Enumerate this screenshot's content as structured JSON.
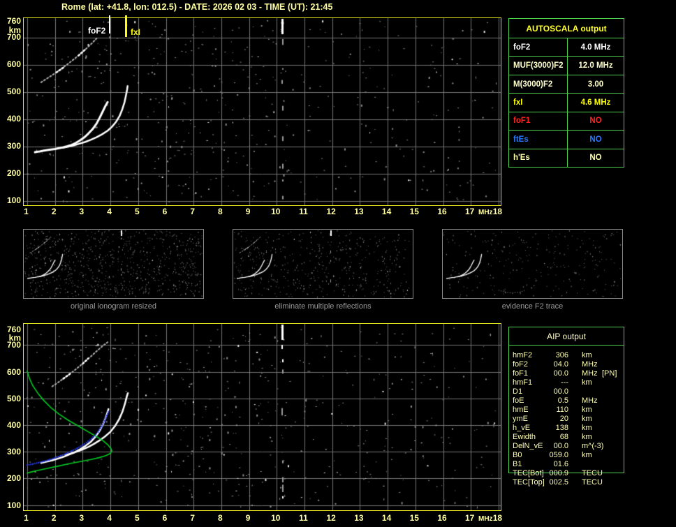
{
  "title": "Rome (lat: +41.8, lon: 012.5) - DATE: 2026 02 03 - TIME (UT): 21:45",
  "colors": {
    "pale_yellow": "#ffffa2",
    "bright_yellow": "#ffff00",
    "plot_border_yellow": "#e8e81e",
    "table_green": "#4cd24c",
    "profile_green": "#00cc22",
    "restored_trace_blue": "#2236e8",
    "alert_red": "#ff2222",
    "es_blue": "#2979ff",
    "grid_gray": "#767676"
  },
  "autoscala_table": {
    "header": "AUTOSCALA output",
    "rows": [
      {
        "label": "foF2",
        "value": "4.0 MHz",
        "color": "#ffffff"
      },
      {
        "label": "MUF(3000)F2",
        "value": "12.0 MHz",
        "color": "#ffffcc"
      },
      {
        "label": "M(3000)F2",
        "value": "3.00",
        "color": "#ffffcc"
      },
      {
        "label": "fxI",
        "value": "4.6 MHz",
        "color": "#ffff00"
      },
      {
        "label": "foF1",
        "value": "NO",
        "color": "#ff2222"
      },
      {
        "label": "ftEs",
        "value": "NO",
        "color": "#2979ff"
      },
      {
        "label": "h'Es",
        "value": "NO",
        "color": "#ffffaa"
      }
    ]
  },
  "aip_table": {
    "header": "AIP output",
    "rows": [
      {
        "label": "hmF2",
        "value": "306",
        "unit": "km",
        "extra": ""
      },
      {
        "label": "foF2",
        "value": "04.0",
        "unit": "MHz",
        "extra": ""
      },
      {
        "label": "foF1",
        "value": "00.0",
        "unit": "MHz",
        "extra": "[PN]"
      },
      {
        "label": "hmF1",
        "value": "---",
        "unit": "km",
        "extra": ""
      },
      {
        "label": "D1",
        "value": "00.0",
        "unit": "",
        "extra": ""
      },
      {
        "label": "foE",
        "value": "0.5",
        "unit": "MHz",
        "extra": ""
      },
      {
        "label": "hmE",
        "value": "110",
        "unit": "km",
        "extra": ""
      },
      {
        "label": "ymE",
        "value": "20",
        "unit": "km",
        "extra": ""
      },
      {
        "label": "h_vE",
        "value": "138",
        "unit": "km",
        "extra": ""
      },
      {
        "label": "Ewidth",
        "value": "68",
        "unit": "km",
        "extra": ""
      },
      {
        "label": "DelN_vE",
        "value": "00.0",
        "unit": "m^(-3)",
        "extra": ""
      },
      {
        "label": "B0",
        "value": "059.0",
        "unit": "km",
        "extra": ""
      },
      {
        "label": "B1",
        "value": "01.6",
        "unit": "",
        "extra": ""
      },
      {
        "label": "TEC[Bot]",
        "value": "000.9",
        "unit": "TECU",
        "extra": ""
      },
      {
        "label": "TEC[Top]",
        "value": "002.5",
        "unit": "TECU",
        "extra": ""
      }
    ]
  },
  "thumbnails": [
    {
      "caption": "original ionogram resized",
      "noise_dots": 780,
      "show_second_order": true,
      "show_interference": true
    },
    {
      "caption": "eliminate multiple reflections",
      "noise_dots": 470,
      "show_second_order": true,
      "show_interference": true
    },
    {
      "caption": "evidence F2 trace",
      "noise_dots": 250,
      "show_second_order": false,
      "show_interference": false,
      "extra_arc": [
        [
          6.3,
          160
        ],
        [
          6.9,
          140
        ],
        [
          7.6,
          132
        ],
        [
          8.3,
          142
        ],
        [
          8.7,
          158
        ]
      ]
    }
  ],
  "chart_data": [
    {
      "id": "main-ionogram",
      "type": "scatter",
      "xlabel": "MHz",
      "ylabel": "km",
      "xlim": [
        1,
        18
      ],
      "ylim": [
        100,
        760
      ],
      "xticks": [
        1,
        2,
        3,
        4,
        5,
        6,
        7,
        8,
        9,
        10,
        11,
        12,
        13,
        14,
        15,
        16,
        17,
        18
      ],
      "yticks": [
        760,
        700,
        600,
        500,
        400,
        300,
        200,
        100
      ],
      "grid": true,
      "markers": [
        {
          "name": "foF2",
          "x": 4.0,
          "color": "#ffffff"
        },
        {
          "name": "fxI",
          "x": 4.6,
          "color": "#ffff00"
        }
      ],
      "noise_dots": 520,
      "seed": 11,
      "series": [
        {
          "name": "F2-trace-ordinary",
          "style": "trace",
          "color": "#ffffff",
          "width": 3,
          "points": [
            [
              1.28,
              279
            ],
            [
              1.38,
              281
            ],
            [
              1.45,
              282
            ],
            [
              1.6,
              285
            ],
            [
              1.8,
              288
            ],
            [
              2.0,
              291
            ],
            [
              2.15,
              294
            ],
            [
              2.3,
              297
            ],
            [
              2.45,
              301
            ],
            [
              2.6,
              306
            ],
            [
              2.75,
              313
            ],
            [
              2.9,
              322
            ],
            [
              3.05,
              333
            ],
            [
              3.2,
              347
            ],
            [
              3.35,
              363
            ],
            [
              3.5,
              384
            ],
            [
              3.62,
              407
            ],
            [
              3.72,
              428
            ],
            [
              3.8,
              445
            ],
            [
              3.86,
              456
            ],
            [
              3.9,
              463
            ]
          ]
        },
        {
          "name": "F2-trace-extraordinary",
          "style": "trace",
          "color": "#ffffff",
          "width": 2.5,
          "points": [
            [
              2.3,
              296
            ],
            [
              2.5,
              300
            ],
            [
              2.7,
              305
            ],
            [
              2.9,
              311
            ],
            [
              3.1,
              317
            ],
            [
              3.3,
              325
            ],
            [
              3.5,
              334
            ],
            [
              3.7,
              345
            ],
            [
              3.9,
              358
            ],
            [
              4.05,
              372
            ],
            [
              4.2,
              390
            ],
            [
              4.33,
              412
            ],
            [
              4.43,
              437
            ],
            [
              4.51,
              463
            ],
            [
              4.56,
              487
            ],
            [
              4.6,
              508
            ],
            [
              4.62,
              522
            ]
          ]
        },
        {
          "name": "second-order-reflection",
          "style": "dashtrace",
          "color": "#b0b0b0",
          "width": 2,
          "points": [
            [
              1.5,
              536
            ],
            [
              1.7,
              549
            ],
            [
              1.9,
              562
            ],
            [
              2.1,
              576
            ],
            [
              2.3,
              591
            ],
            [
              2.5,
              606
            ],
            [
              2.7,
              622
            ],
            [
              2.9,
              639
            ],
            [
              3.1,
              657
            ],
            [
              3.3,
              676
            ],
            [
              3.5,
              697
            ]
          ]
        },
        {
          "name": "second-order-bright-1",
          "style": "dashtrace",
          "color": "#ffffff",
          "width": 2.5,
          "points": [
            [
              2.05,
              572
            ],
            [
              2.35,
              593
            ]
          ]
        },
        {
          "name": "second-order-bright-2",
          "style": "dashtrace",
          "color": "#ffffff",
          "width": 2.5,
          "points": [
            [
              2.85,
              634
            ],
            [
              3.12,
              659
            ]
          ]
        },
        {
          "name": "interference-line",
          "style": "vnoise",
          "x": 10.2
        }
      ]
    },
    {
      "id": "profile-ionogram",
      "type": "scatter",
      "xlabel": "MHz",
      "ylabel": "km",
      "xlim": [
        1,
        18
      ],
      "ylim": [
        100,
        760
      ],
      "xticks": [
        1,
        2,
        3,
        4,
        5,
        6,
        7,
        8,
        9,
        10,
        11,
        12,
        13,
        14,
        15,
        16,
        17,
        18
      ],
      "yticks": [
        760,
        700,
        600,
        500,
        400,
        300,
        200,
        100
      ],
      "grid": true,
      "markers": [],
      "noise_dots": 560,
      "seed": 22,
      "series": [
        {
          "name": "F2-trace-ordinary",
          "style": "trace",
          "color": "#ffffff",
          "width": 2.5,
          "points": [
            [
              1.5,
              258
            ],
            [
              1.7,
              263
            ],
            [
              1.9,
              268
            ],
            [
              2.1,
              274
            ],
            [
              2.3,
              281
            ],
            [
              2.5,
              289
            ],
            [
              2.7,
              298
            ],
            [
              2.9,
              309
            ],
            [
              3.1,
              322
            ],
            [
              3.3,
              338
            ],
            [
              3.45,
              355
            ],
            [
              3.6,
              377
            ],
            [
              3.72,
              400
            ],
            [
              3.82,
              425
            ],
            [
              3.89,
              447
            ],
            [
              3.93,
              460
            ]
          ]
        },
        {
          "name": "F2-trace-extraordinary",
          "style": "trace",
          "color": "#ffffff",
          "width": 2.5,
          "points": [
            [
              2.4,
              288
            ],
            [
              2.6,
              294
            ],
            [
              2.8,
              301
            ],
            [
              3.0,
              309
            ],
            [
              3.2,
              318
            ],
            [
              3.4,
              329
            ],
            [
              3.6,
              342
            ],
            [
              3.8,
              357
            ],
            [
              4.0,
              375
            ],
            [
              4.17,
              397
            ],
            [
              4.32,
              423
            ],
            [
              4.44,
              452
            ],
            [
              4.53,
              482
            ],
            [
              4.59,
              507
            ],
            [
              4.63,
              520
            ]
          ]
        },
        {
          "name": "second-order-reflection",
          "style": "dashtrace",
          "color": "#b0b0b0",
          "width": 2,
          "points": [
            [
              1.9,
              545
            ],
            [
              2.1,
              559
            ],
            [
              2.3,
              574
            ],
            [
              2.5,
              589
            ],
            [
              2.7,
              605
            ],
            [
              2.9,
              622
            ],
            [
              3.1,
              640
            ],
            [
              3.3,
              658
            ],
            [
              3.5,
              677
            ],
            [
              3.7,
              695
            ],
            [
              3.9,
              711
            ]
          ]
        },
        {
          "name": "second-order-bright-1",
          "style": "dashtrace",
          "color": "#ffffff",
          "width": 2.5,
          "points": [
            [
              2.3,
              574
            ],
            [
              2.55,
              593
            ]
          ]
        },
        {
          "name": "second-order-bright-2",
          "style": "dashtrace",
          "color": "#ffffff",
          "width": 2.5,
          "points": [
            [
              3.0,
              630
            ],
            [
              3.2,
              650
            ]
          ]
        },
        {
          "name": "interference-line",
          "style": "vnoise",
          "x": 10.2
        },
        {
          "name": "electron-density-profile",
          "style": "line",
          "color": "#00cc22",
          "width": 1.6,
          "points": [
            [
              1.0,
              603
            ],
            [
              1.08,
              575
            ],
            [
              1.2,
              548
            ],
            [
              1.38,
              520
            ],
            [
              1.6,
              492
            ],
            [
              1.85,
              466
            ],
            [
              2.15,
              441
            ],
            [
              2.5,
              417
            ],
            [
              2.85,
              396
            ],
            [
              3.2,
              375
            ],
            [
              3.5,
              357
            ],
            [
              3.75,
              340
            ],
            [
              3.92,
              325
            ],
            [
              4.02,
              312
            ],
            [
              4.05,
              303
            ],
            [
              4.0,
              294
            ],
            [
              3.85,
              286
            ],
            [
              3.6,
              278
            ],
            [
              3.3,
              271
            ],
            [
              2.95,
              264
            ],
            [
              2.55,
              256
            ],
            [
              2.1,
              246
            ],
            [
              1.7,
              237
            ],
            [
              1.35,
              229
            ],
            [
              1.1,
              223
            ],
            [
              1.0,
              220
            ]
          ]
        },
        {
          "name": "restored-F2-trace",
          "style": "dots",
          "color": "#2236e8",
          "points": [
            [
              1.0,
              250
            ],
            [
              1.2,
              254
            ],
            [
              1.4,
              259
            ],
            [
              1.6,
              264
            ],
            [
              1.8,
              270
            ],
            [
              2.0,
              277
            ],
            [
              2.2,
              285
            ],
            [
              2.4,
              293
            ],
            [
              2.6,
              303
            ],
            [
              2.8,
              313
            ],
            [
              3.0,
              325
            ],
            [
              3.2,
              339
            ],
            [
              3.38,
              355
            ],
            [
              3.55,
              374
            ],
            [
              3.68,
              394
            ],
            [
              3.79,
              416
            ],
            [
              3.87,
              436
            ],
            [
              3.93,
              450
            ]
          ]
        }
      ]
    }
  ]
}
